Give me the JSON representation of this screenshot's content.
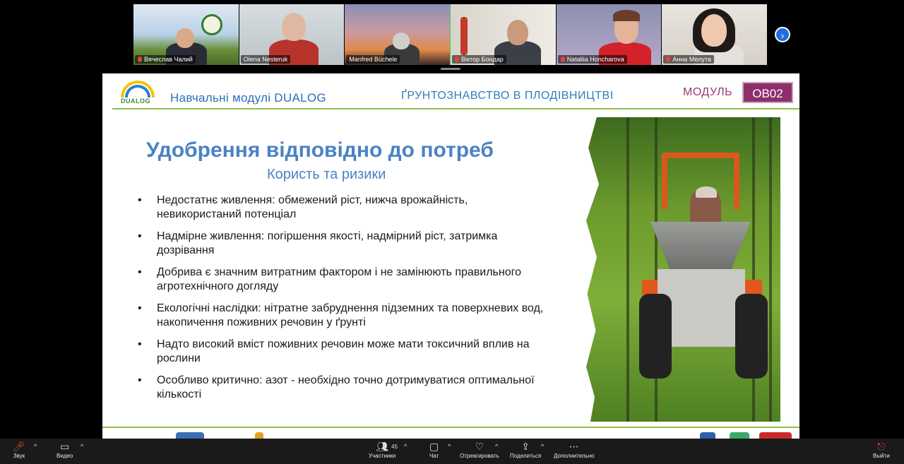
{
  "participants": [
    {
      "name": "Вячеслав Чалий",
      "muted": true
    },
    {
      "name": "Olena Nesteruk",
      "muted": false
    },
    {
      "name": "Manfred Büchele",
      "muted": false,
      "active": true
    },
    {
      "name": "Віктор Бондар",
      "muted": true
    },
    {
      "name": "Nataliia Honcharova",
      "muted": true
    },
    {
      "name": "Анна Мелута",
      "muted": true
    }
  ],
  "next_label": "›",
  "slide": {
    "logo_text": "DUALOG",
    "header_left": "Навчальні модулі  DUALOG",
    "header_center": "ҐРУНТОЗНАВСТВО В ПЛОДІВНИЦТВІ",
    "module_label": "МОДУЛЬ",
    "module_code": "OB02",
    "title": "Удобрення відповідно до потреб",
    "subtitle": "Користь та ризики",
    "bullets": [
      "Недостатнє живлення: обмежений ріст, нижча врожайність, невикористаний потенціал",
      "Надмірне живлення: погіршення якості, надмірний ріст, затримка дозрівання",
      "Добрива є значним витратним фактором і не замінюють правильного агротехнічного догляду",
      "Екологічні наслідки: нітратне забруднення підземних та поверхневих вод, накопичення поживних речовин у ґрунті",
      "Надто високий вміст поживних речовин може мати токсичний вплив на рослини",
      "Особливо критично: азот - необхідно точно дотримуватися оптимальної кількості"
    ]
  },
  "toolbar": {
    "audio": "Звук",
    "video": "Видео",
    "participants": "Участники",
    "participants_count": "45",
    "chat": "Чат",
    "react": "Отреагировать",
    "share": "Поделиться",
    "more": "Дополнительно",
    "leave": "Выйти"
  },
  "colors": {
    "title_blue": "#4a82c4",
    "module_purple": "#8c2f6b",
    "accent_green": "#8fc04a",
    "active_tile": "#3ad46a"
  }
}
